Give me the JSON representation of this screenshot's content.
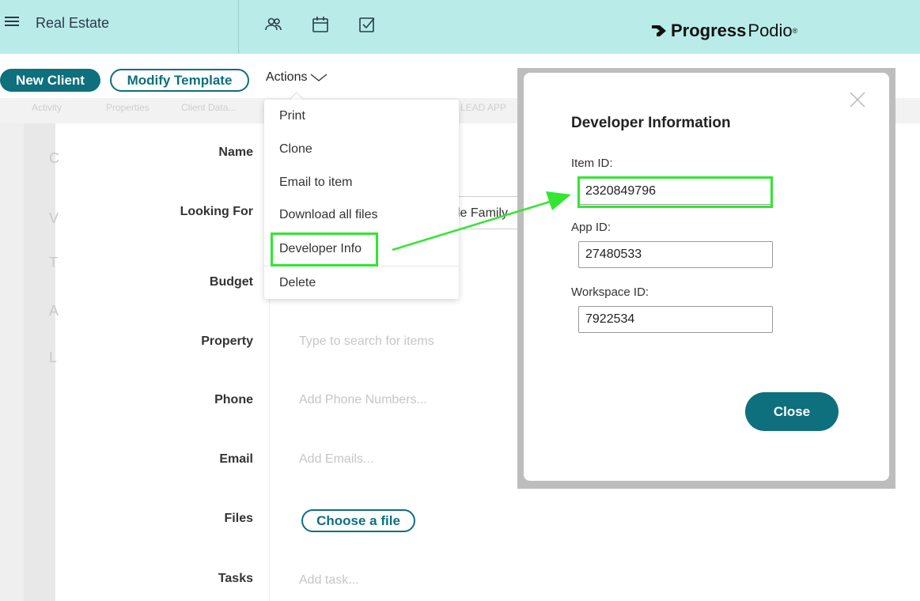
{
  "header": {
    "workspace_title": "Real Estate",
    "brand_bold": "Progress",
    "brand_light": "Podio",
    "brand_mark": "®",
    "icons": [
      "contacts-icon",
      "calendar-icon",
      "tasks-icon"
    ]
  },
  "appbar": {
    "new_button": "New Client",
    "modify_button": "Modify Template",
    "actions_label": "Actions"
  },
  "tabs": [
    "Activity",
    "Properties",
    "Client Data...",
    "LEAD APP"
  ],
  "form": {
    "fields": [
      {
        "label": "Name",
        "value": ""
      },
      {
        "label": "Looking For",
        "value": ""
      },
      {
        "label": "Budget",
        "value": ""
      },
      {
        "label": "Property",
        "value": "Type to search for items"
      },
      {
        "label": "Phone",
        "value": "Add Phone Numbers..."
      },
      {
        "label": "Email",
        "value": "Add Emails..."
      },
      {
        "label": "Files",
        "value": ""
      },
      {
        "label": "Tasks",
        "value": "Add task..."
      }
    ],
    "choose_file": "Choose a file",
    "looking_for_partial": "le Family"
  },
  "dropdown": {
    "items": [
      "Print",
      "Clone",
      "Email to item",
      "Download all files",
      "Developer Info",
      "Delete"
    ]
  },
  "modal": {
    "title": "Developer Information",
    "item_id_label": "Item ID:",
    "item_id": "2320849796",
    "app_id_label": "App ID:",
    "app_id": "27480533",
    "workspace_id_label": "Workspace ID:",
    "workspace_id": "7922534",
    "close_button": "Close"
  },
  "colors": {
    "accent": "#0e6f7d",
    "topbar": "#b9ece8",
    "highlight": "#32e632"
  }
}
